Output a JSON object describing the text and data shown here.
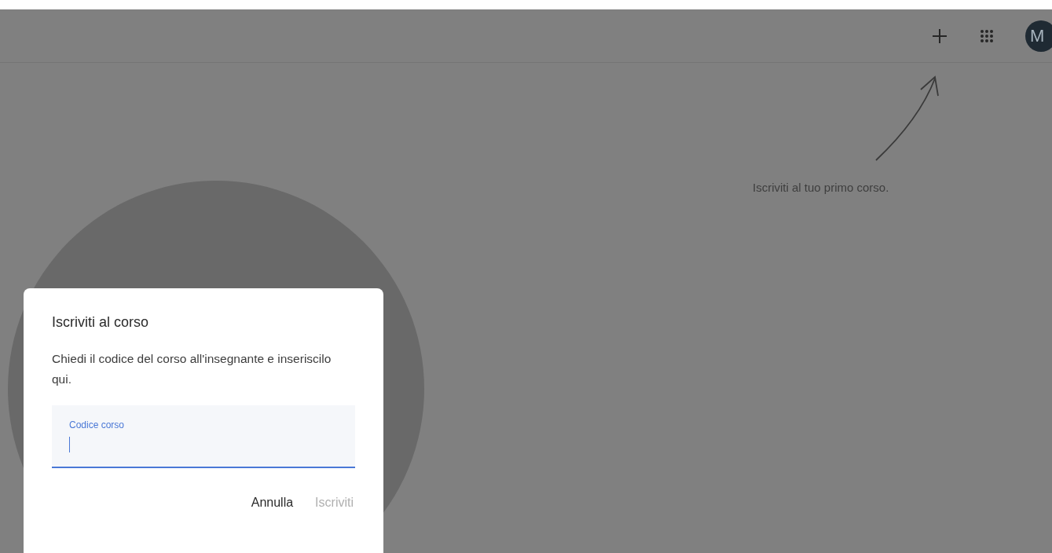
{
  "header": {
    "avatar": "M"
  },
  "hint": "Iscriviti al tuo primo corso.",
  "dialog": {
    "title": "Iscriviti al corso",
    "body": "Chiedi il codice del corso all'insegnante e inseriscilo qui.",
    "field": {
      "label": "Codice corso",
      "focused": true
    },
    "buttons": [
      {
        "label": "Annulla",
        "disabled": false
      },
      {
        "label": "Iscriviti",
        "disabled": true
      }
    ]
  }
}
